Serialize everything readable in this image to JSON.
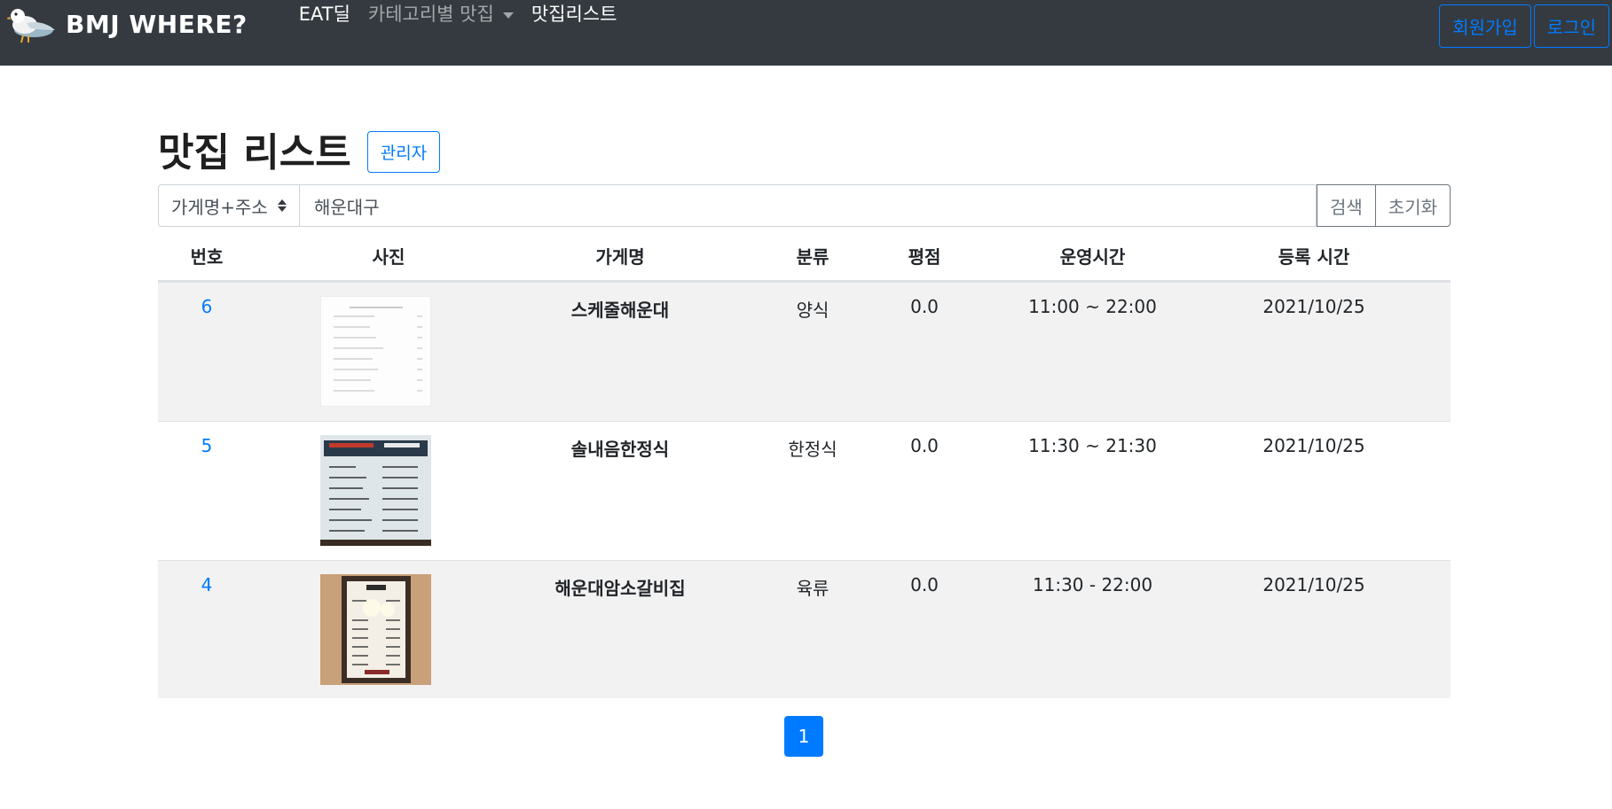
{
  "navbar": {
    "brand": "BMJ WHERE?",
    "links": [
      "EAT딜",
      "카테고리별 맛집",
      "맛집리스트"
    ],
    "signup": "회원가입",
    "login": "로그인"
  },
  "heading": {
    "title": "맛집 리스트",
    "admin": "관리자"
  },
  "search": {
    "select_value": "가게명+주소",
    "input_value": "해운대구",
    "search_button": "검색",
    "reset_button": "초기화"
  },
  "table": {
    "columns": [
      "번호",
      "사진",
      "가게명",
      "분류",
      "평점",
      "운영시간",
      "등록 시간"
    ],
    "rows": [
      {
        "num": "6",
        "name": "스케줄해운대",
        "category": "양식",
        "rating": "0.0",
        "hours": "11:00 ~ 22:00",
        "date": "2021/10/25"
      },
      {
        "num": "5",
        "name": "솔내음한정식",
        "category": "한정식",
        "rating": "0.0",
        "hours": "11:30 ~ 21:30",
        "date": "2021/10/25"
      },
      {
        "num": "4",
        "name": "해운대암소갈비집",
        "category": "육류",
        "rating": "0.0",
        "hours": "11:30 - 22:00",
        "date": "2021/10/25"
      }
    ]
  },
  "pagination": {
    "current": "1"
  },
  "colors": {
    "navbar": "#343a40",
    "primary": "#007bff",
    "row_shade": "#f2f2f2"
  }
}
